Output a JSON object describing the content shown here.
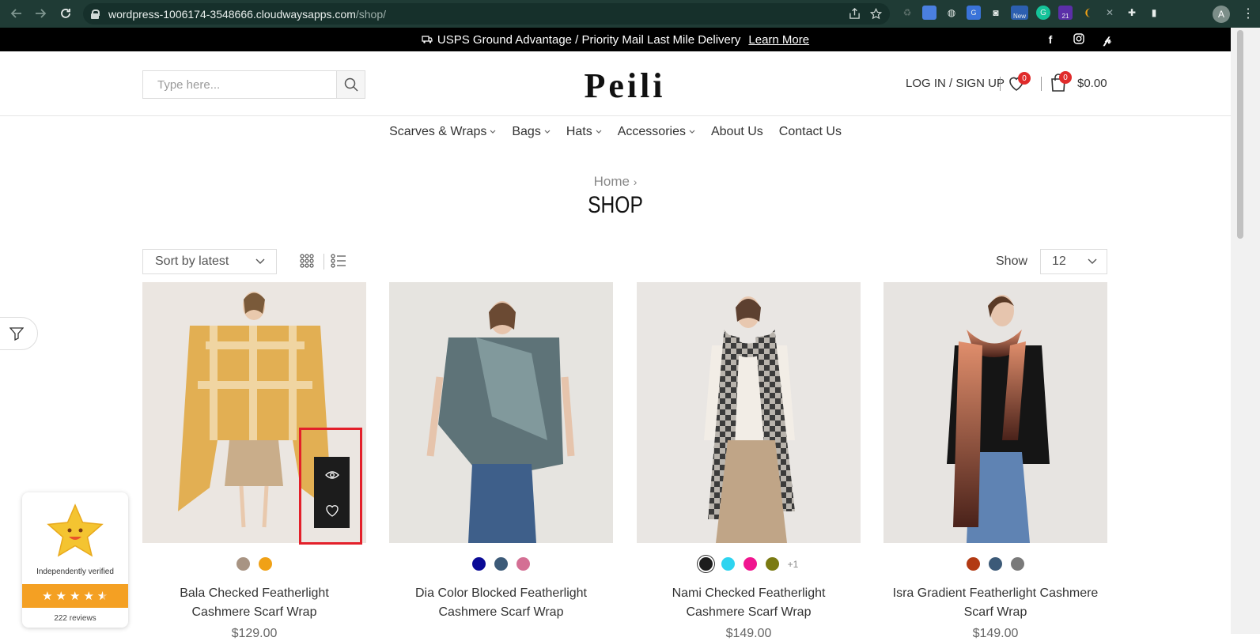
{
  "browser": {
    "url_host": "wordpress-1006174-3548666.cloudwaysapps.com",
    "url_path": "/shop/",
    "profile_initial": "A",
    "ext_new_badge": "New",
    "ext_count_badge": "21"
  },
  "announcement": {
    "text": "USPS Ground Advantage / Priority Mail Last Mile Delivery",
    "link": "Learn More"
  },
  "header": {
    "search_placeholder": "Type here...",
    "logo": "Peili",
    "account": "LOG IN / SIGN UP",
    "wishlist_count": "0",
    "cart_count": "0",
    "cart_total": "$0.00"
  },
  "menu": [
    {
      "label": "Scarves & Wraps",
      "has_dropdown": true
    },
    {
      "label": "Bags",
      "has_dropdown": true
    },
    {
      "label": "Hats",
      "has_dropdown": true
    },
    {
      "label": "Accessories",
      "has_dropdown": true
    },
    {
      "label": "About Us",
      "has_dropdown": false
    },
    {
      "label": "Contact Us",
      "has_dropdown": false
    }
  ],
  "breadcrumb": {
    "home": "Home",
    "sep": "›"
  },
  "page_title": "SHOP",
  "toolbar": {
    "sort_value": "Sort by latest",
    "show_label": "Show",
    "show_value": "12"
  },
  "products": [
    {
      "name": "Bala Checked Featherlight Cashmere Scarf Wrap",
      "price": "$129.00",
      "swatches": [
        "#a89483",
        "#f0a116"
      ],
      "more": "",
      "image_colors": [
        "#ebe6e1",
        "#e0a53a",
        "#f2dfae"
      ]
    },
    {
      "name": "Dia Color Blocked Featherlight Cashmere Scarf Wrap",
      "price": "$129.00",
      "swatches": [
        "#0a0a96",
        "#3c5a78",
        "#d46f94"
      ],
      "more": "",
      "image_colors": [
        "#e6e4e0",
        "#5e7378",
        "#8aa2a5"
      ]
    },
    {
      "name": "Nami Checked Featherlight Cashmere Scarf Wrap",
      "price": "$149.00",
      "swatches": [
        "#1d1d1d",
        "#2ed4f0",
        "#f0158f",
        "#7a7a12"
      ],
      "more": "+1",
      "image_colors": [
        "#e9e6e3",
        "#3b3b3b",
        "#b9b4ad"
      ]
    },
    {
      "name": "Isra Gradient Featherlight Cashmere Scarf Wrap",
      "price": "$149.00",
      "swatches": [
        "#b23a13",
        "#3c5a78",
        "#7a7a7a"
      ],
      "more": "",
      "image_colors": [
        "#e7e4e1",
        "#d9805e",
        "#5a2a1e"
      ]
    }
  ],
  "reviews_widget": {
    "verified": "Independently verified",
    "count": "222 reviews",
    "rating": 4.5
  }
}
